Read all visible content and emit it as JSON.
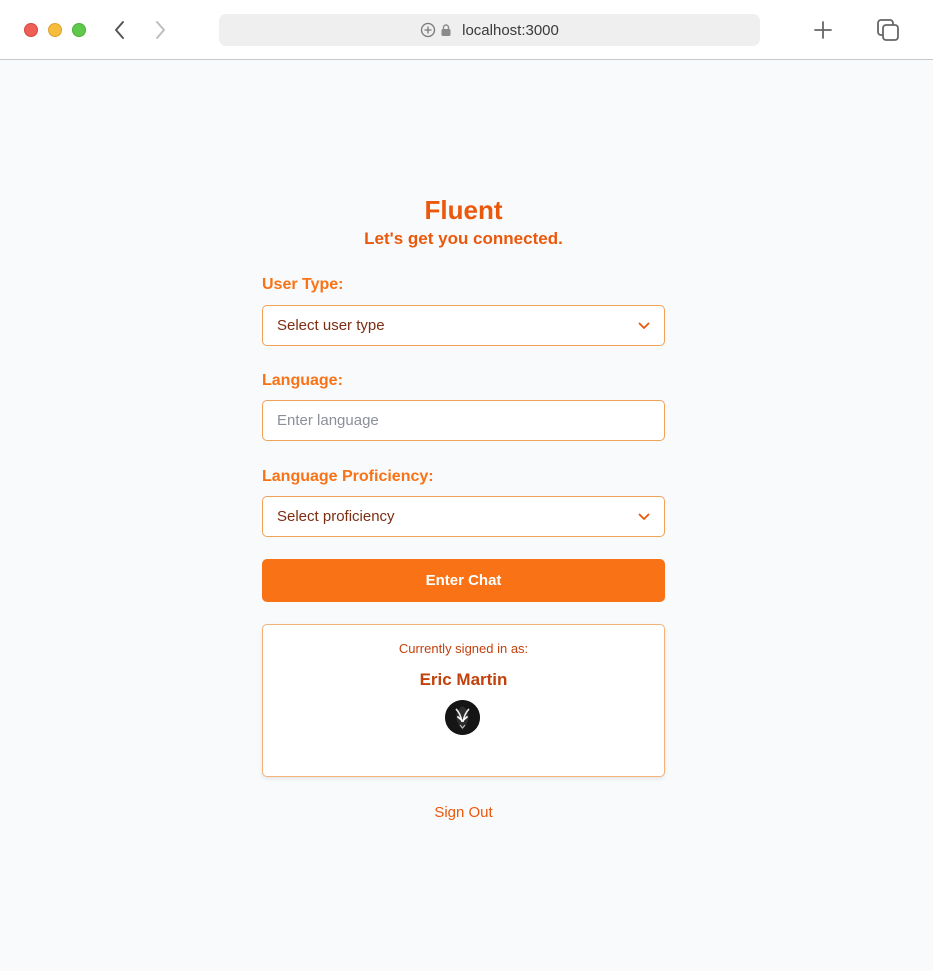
{
  "browser": {
    "url": "localhost:3000"
  },
  "app": {
    "title": "Fluent",
    "subtitle": "Let's get you connected."
  },
  "form": {
    "user_type_label": "User Type:",
    "user_type_value": "Select user type",
    "language_label": "Language:",
    "language_placeholder": "Enter language",
    "proficiency_label": "Language Proficiency:",
    "proficiency_value": "Select proficiency",
    "submit_label": "Enter Chat"
  },
  "account": {
    "signed_in_label": "Currently signed in as:",
    "user_name": "Eric Martin",
    "avatar_icon": "avatar-icon"
  },
  "signout_label": "Sign Out",
  "colors": {
    "accent": "#f97316",
    "accent_dark": "#ea580c",
    "border": "#f0a25a",
    "background": "#f9fafb"
  }
}
